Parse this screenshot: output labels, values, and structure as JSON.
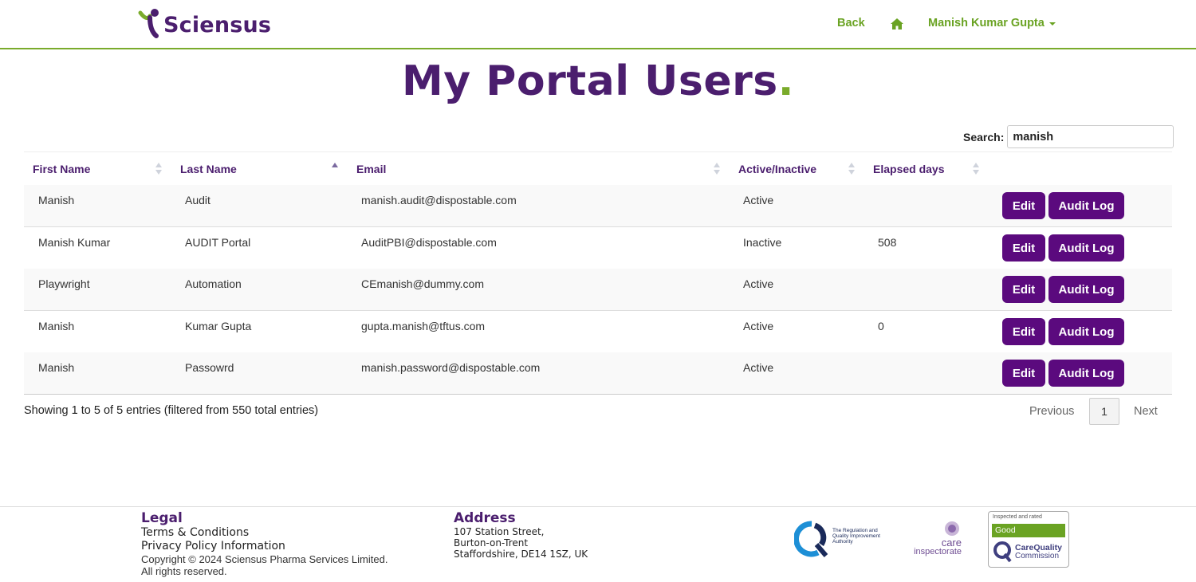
{
  "header": {
    "brand": "Sciensus",
    "nav_back": "Back",
    "nav_user": "Manish Kumar Gupta"
  },
  "page_title": "My Portal Users",
  "page_title_dot": ".",
  "search": {
    "label": "Search:",
    "value": "manish"
  },
  "table": {
    "columns": [
      "First Name",
      "Last Name",
      "Email",
      "Active/Inactive",
      "Elapsed days"
    ],
    "sorted_column": "Last Name",
    "rows": [
      {
        "first": "Manish",
        "last": "Audit",
        "email": "manish.audit@dispostable.com",
        "status": "Active",
        "days": ""
      },
      {
        "first": "Manish Kumar",
        "last": "AUDIT Portal",
        "email": "AuditPBI@dispostable.com",
        "status": "Inactive",
        "days": "508"
      },
      {
        "first": "Playwright",
        "last": "Automation",
        "email": "CEmanish@dummy.com",
        "status": "Active",
        "days": ""
      },
      {
        "first": "Manish",
        "last": "Kumar Gupta",
        "email": "gupta.manish@tftus.com",
        "status": "Active",
        "days": "0"
      },
      {
        "first": "Manish",
        "last": "Passowrd",
        "email": "manish.password@dispostable.com",
        "status": "Active",
        "days": ""
      }
    ],
    "edit_label": "Edit",
    "audit_label": "Audit Log"
  },
  "info": "Showing 1 to 5 of 5 entries (filtered from 550 total entries)",
  "pagination": {
    "previous": "Previous",
    "current": "1",
    "next": "Next"
  },
  "footer": {
    "legal_heading": "Legal",
    "terms": "Terms & Conditions",
    "privacy": "Privacy Policy Information",
    "copyright": "Copyright © 2024 Sciensus Pharma Services Limited.",
    "rights": "All rights reserved.",
    "address_heading": "Address",
    "address_lines": [
      "107 Station Street,",
      "Burton-on-Trent",
      "Staffordshire, DE14 1SZ, UK"
    ],
    "rqia_text": "The Regulation and Quality Improvement Authority",
    "care_text_1": "care",
    "care_text_2": "inspectorate",
    "cqc_top": "Inspected and rated",
    "cqc_rating": "Good",
    "cqc_name_1": "CareQuality",
    "cqc_name_2": "Commission"
  },
  "colors": {
    "brand_purple": "#4b1e6e",
    "button_purple": "#5b0a7e",
    "brand_green": "#7aab2b",
    "nav_green": "#6aa323"
  }
}
